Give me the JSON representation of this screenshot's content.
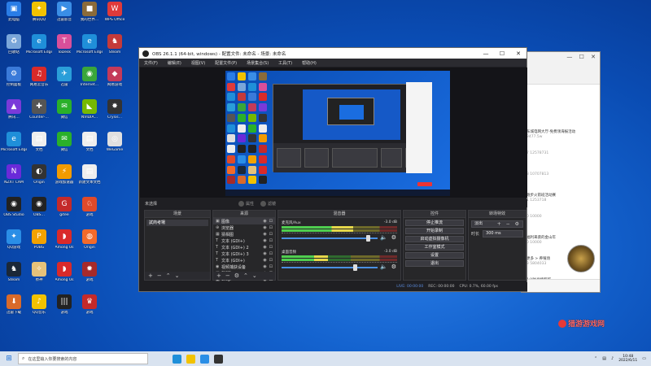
{
  "desktop_icons": [
    {
      "label": "此电脑",
      "color": "#2a7de6",
      "glyph": "▣",
      "col": 0,
      "row": 0
    },
    {
      "label": "腾讯QQ",
      "color": "#f2c200",
      "glyph": "✦",
      "col": 1,
      "row": 0
    },
    {
      "label": "迅雷影音",
      "color": "#3a8ee6",
      "glyph": "▶",
      "col": 2,
      "row": 0
    },
    {
      "label": "我的世界…",
      "color": "#8b6b3a",
      "glyph": "■",
      "col": 3,
      "row": 0
    },
    {
      "label": "WPS Office",
      "color": "#e03a3a",
      "glyph": "W",
      "col": 4,
      "row": 0
    },
    {
      "label": "回收站",
      "color": "#7aa6d9",
      "glyph": "♻",
      "col": 0,
      "row": 1
    },
    {
      "label": "Microsoft Edge",
      "color": "#1f8fd9",
      "glyph": "e",
      "col": 1,
      "row": 1
    },
    {
      "label": "ToDesk",
      "color": "#d94f9a",
      "glyph": "T",
      "col": 2,
      "row": 1
    },
    {
      "label": "Microsoft Edge",
      "color": "#1f8fd9",
      "glyph": "e",
      "col": 3,
      "row": 1
    },
    {
      "label": "Steam",
      "color": "#c43a3a",
      "glyph": "♞",
      "col": 4,
      "row": 1
    },
    {
      "label": "控制面板",
      "color": "#3a7ad9",
      "glyph": "⚙",
      "col": 0,
      "row": 2
    },
    {
      "label": "网易云音乐",
      "color": "#d92a2a",
      "glyph": "♫",
      "col": 1,
      "row": 2
    },
    {
      "label": "迅雷",
      "color": "#2a9ed9",
      "glyph": "✈",
      "col": 2,
      "row": 2
    },
    {
      "label": "Internet…",
      "color": "#3aa63a",
      "glyph": "◉",
      "col": 3,
      "row": 2
    },
    {
      "label": "网易游戏",
      "color": "#c43a5a",
      "glyph": "◆",
      "col": 4,
      "row": 2
    },
    {
      "label": "腾讯…",
      "color": "#7a3ad9",
      "glyph": "▲",
      "col": 0,
      "row": 3
    },
    {
      "label": "Counter-…",
      "color": "#555555",
      "glyph": "✚",
      "col": 1,
      "row": 3
    },
    {
      "label": "微信",
      "color": "#2ab02a",
      "glyph": "✉",
      "col": 2,
      "row": 3
    },
    {
      "label": "NVIDIA…",
      "color": "#76b900",
      "glyph": "◣",
      "col": 3,
      "row": 3
    },
    {
      "label": "Crysis…",
      "color": "#333333",
      "glyph": "✸",
      "col": 4,
      "row": 3
    },
    {
      "label": "Microsoft Edge",
      "color": "#1f8fd9",
      "glyph": "e",
      "col": 0,
      "row": 4
    },
    {
      "label": "文档",
      "color": "#eeeeee",
      "glyph": "▤",
      "col": 1,
      "row": 4
    },
    {
      "label": "微信",
      "color": "#2ab02a",
      "glyph": "✉",
      "col": 2,
      "row": 4
    },
    {
      "label": "文档",
      "color": "#eeeeee",
      "glyph": "▤",
      "col": 3,
      "row": 4
    },
    {
      "label": "WeGame",
      "color": "#e0e0e0",
      "glyph": "◎",
      "col": 4,
      "row": 4
    },
    {
      "label": "NZXT CAM",
      "color": "#6a2ad9",
      "glyph": "N",
      "col": 0,
      "row": 5
    },
    {
      "label": "Origin",
      "color": "#333333",
      "glyph": "◐",
      "col": 1,
      "row": 5
    },
    {
      "label": "游戏加速器",
      "color": "#f29b00",
      "glyph": "⚡",
      "col": 2,
      "row": 5
    },
    {
      "label": "新建文本文档",
      "color": "#eeeeee",
      "glyph": "▤",
      "col": 3,
      "row": 5
    },
    {
      "label": "OBS Studio",
      "color": "#222222",
      "glyph": "◉",
      "col": 0,
      "row": 6
    },
    {
      "label": "OBS…",
      "color": "#222222",
      "glyph": "◉",
      "col": 1,
      "row": 6
    },
    {
      "label": "gitee",
      "color": "#c42a2a",
      "glyph": "G",
      "col": 2,
      "row": 6
    },
    {
      "label": "游戏",
      "color": "#e04a2a",
      "glyph": "♘",
      "col": 3,
      "row": 6
    },
    {
      "label": "QQ游戏",
      "color": "#2a8ee6",
      "glyph": "✦",
      "col": 0,
      "row": 7
    },
    {
      "label": "PUBG",
      "color": "#f2a200",
      "glyph": "P",
      "col": 1,
      "row": 7
    },
    {
      "label": "Among Us",
      "color": "#d92a2a",
      "glyph": "◗",
      "col": 2,
      "row": 7
    },
    {
      "label": "Origin",
      "color": "#f26a2a",
      "glyph": "◍",
      "col": 3,
      "row": 7
    },
    {
      "label": "Steam",
      "color": "#1b2838",
      "glyph": "♞",
      "col": 0,
      "row": 8
    },
    {
      "label": "原神",
      "color": "#e6c27a",
      "glyph": "✧",
      "col": 1,
      "row": 8
    },
    {
      "label": "Among Us",
      "color": "#d92a2a",
      "glyph": "◗",
      "col": 2,
      "row": 8
    },
    {
      "label": "游戏",
      "color": "#a62a2a",
      "glyph": "✹",
      "col": 3,
      "row": 8
    },
    {
      "label": "迅雷下载",
      "color": "#d96a2a",
      "glyph": "⬇",
      "col": 0,
      "row": 9
    },
    {
      "label": "QQ音乐",
      "color": "#f2c200",
      "glyph": "♪",
      "col": 1,
      "row": 9
    },
    {
      "label": "游戏",
      "color": "#222222",
      "glyph": "|||",
      "col": 2,
      "row": 9
    },
    {
      "label": "游戏",
      "color": "#c42a2a",
      "glyph": "♛",
      "col": 3,
      "row": 9
    }
  ],
  "obs": {
    "title": "OBS 26.1.1 (64-bit, windows) - 配置文件: 未命名 - 场景: 未命名",
    "menus": [
      "文件(F)",
      "编辑(E)",
      "视图(V)",
      "配置文件(P)",
      "场景集合(S)",
      "工具(T)",
      "帮助(H)"
    ],
    "scene_bar": {
      "label": "未选择",
      "properties": "属性",
      "filters": "滤镜"
    },
    "scenes": {
      "header": "场景",
      "items": [
        "試商考場"
      ]
    },
    "sources": {
      "header": "来源",
      "items": [
        {
          "icon": "▣",
          "name": "图像"
        },
        {
          "icon": "⊕",
          "name": "浏览器"
        },
        {
          "icon": "▦",
          "name": "猜相图"
        },
        {
          "icon": "T",
          "name": "文本 (GDI+)"
        },
        {
          "icon": "T",
          "name": "文本 (GDI+) 2"
        },
        {
          "icon": "T",
          "name": "文本 (GDI+) 3"
        },
        {
          "icon": "T",
          "name": "文本 (GDI+)"
        },
        {
          "icon": "◉",
          "name": "视频捕获设备"
        },
        {
          "icon": "▣",
          "name": "CHIJI"
        },
        {
          "icon": "▣",
          "name": "CHIJI"
        }
      ]
    },
    "mixer": {
      "header": "混音器",
      "channels": [
        {
          "name": "麦克风/Aux",
          "db": "-3.0 dB",
          "level": 0.62,
          "volume": 0.9
        },
        {
          "name": "桌面音频",
          "db": "-3.0 dB",
          "level": 0.4,
          "volume": 0.76
        }
      ]
    },
    "controls": {
      "header": "控件",
      "buttons": [
        "停止推流",
        "开始录制",
        "启动虚拟摄像机",
        "工作室模式",
        "设置",
        "退出"
      ]
    },
    "transitions": {
      "header": "转场特效",
      "type": "淡出",
      "duration_label": "时长",
      "duration_value": "300 ms"
    },
    "status": {
      "live": "LIVE: 00:00:00",
      "rec": "REC: 00:00:00",
      "cpu": "CPU: 0.7%, 60.00 fps"
    }
  },
  "bg_chat": {
    "entries": [
      {
        "title": "东城电网大厅-免费领海报活动",
        "sub": "3477.5w"
      },
      {
        "title": "",
        "sub": "7 12578731"
      },
      {
        "title": "",
        "sub": "8 10707813"
      },
      {
        "title": "跑步火箭班活动赛",
        "sub": "1 1253718"
      },
      {
        "title": "",
        "sub": "0 10000"
      },
      {
        "title": "福利来袭的金山年",
        "sub": "0 10000"
      },
      {
        "title": "更多 > 养殖场",
        "sub": "3 5804033"
      },
      {
        "title": "1小时战绩超越",
        "sub": "0 2526200"
      }
    ]
  },
  "watermark": "猎游游戏网",
  "taskbar": {
    "search_placeholder": "在这里输入你要搜索的内容",
    "time": "10:48",
    "date": "2022/6/11",
    "icon_colors": [
      "#1f8fd9",
      "#f2c200",
      "#2a8ee6",
      "#333333"
    ]
  }
}
